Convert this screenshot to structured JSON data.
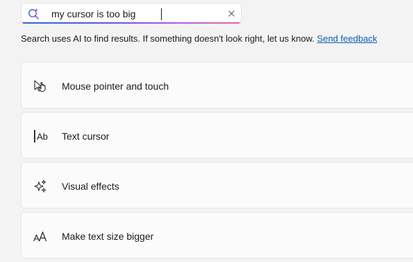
{
  "search": {
    "query": "my cursor is too big",
    "clear_icon": "close-icon",
    "icon": "ai-search-icon",
    "underline_gradient": [
      "#2a6fdb",
      "#6a54e6",
      "#b45fe8",
      "#e86fa5"
    ]
  },
  "notice": {
    "text": "Search uses AI to find results. If something doesn't look right, let us know.",
    "link_label": "Send feedback",
    "link_color": "#0a5fb4"
  },
  "results": [
    {
      "label": "Mouse pointer and touch",
      "icon": "mouse-pointer-touch-icon"
    },
    {
      "label": "Text cursor",
      "icon": "text-cursor-icon"
    },
    {
      "label": "Visual effects",
      "icon": "sparkle-icon"
    },
    {
      "label": "Make text size bigger",
      "icon": "text-size-icon"
    }
  ],
  "colors": {
    "background": "#f3f3f3",
    "card": "#fbfbfb",
    "text": "#1b1b1b"
  }
}
